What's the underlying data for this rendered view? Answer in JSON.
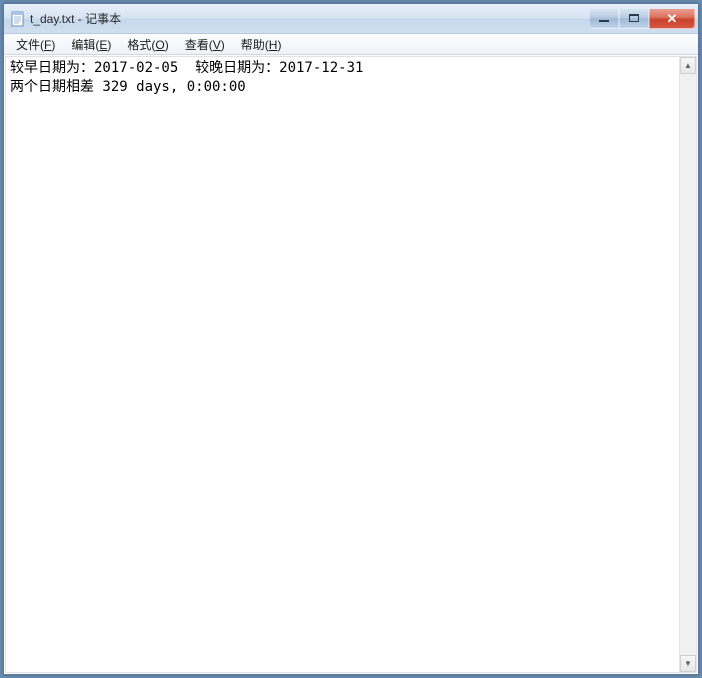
{
  "titlebar": {
    "title": "t_day.txt - 记事本"
  },
  "menubar": {
    "items": [
      {
        "label": "文件",
        "key": "F"
      },
      {
        "label": "编辑",
        "key": "E"
      },
      {
        "label": "格式",
        "key": "O"
      },
      {
        "label": "查看",
        "key": "V"
      },
      {
        "label": "帮助",
        "key": "H"
      }
    ]
  },
  "content": {
    "line1": "较早日期为：2017-02-05  较晚日期为：2017-12-31",
    "line2": "两个日期相差 329 days, 0:00:00"
  },
  "scrollbar": {
    "up_arrow": "▲",
    "down_arrow": "▼"
  }
}
